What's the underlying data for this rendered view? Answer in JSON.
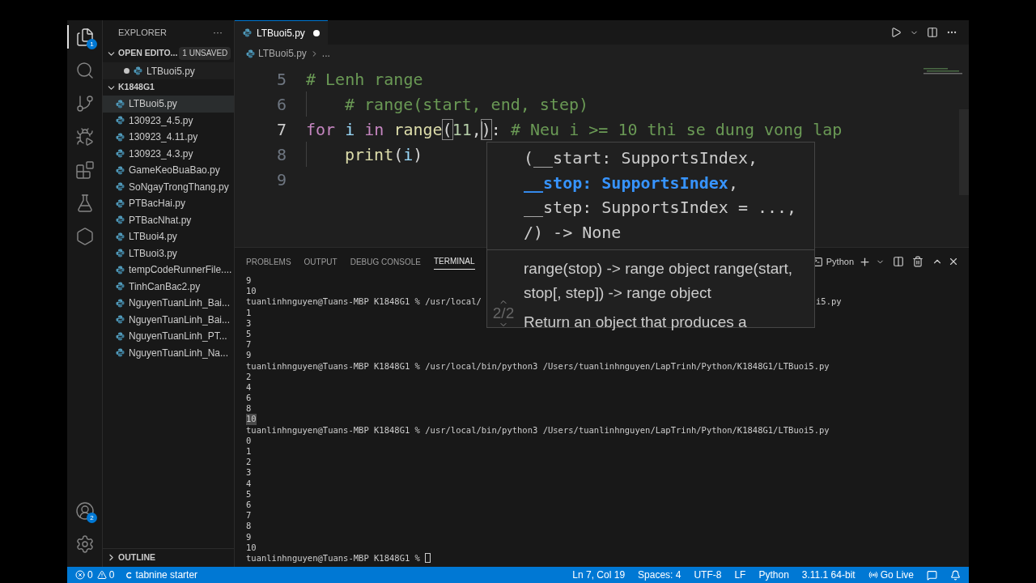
{
  "activity_bar": {
    "top": [
      {
        "kind": "files",
        "badge": "1",
        "selected": true
      },
      {
        "kind": "search",
        "selected": false
      },
      {
        "kind": "source-control",
        "selected": false
      },
      {
        "kind": "run-debug",
        "selected": false
      },
      {
        "kind": "extensions",
        "selected": false
      },
      {
        "kind": "testing",
        "selected": false
      },
      {
        "kind": "remote",
        "selected": false
      }
    ],
    "bottom": [
      {
        "kind": "account",
        "badge": "2"
      },
      {
        "kind": "settings"
      }
    ]
  },
  "sidebar": {
    "title": "EXPLORER",
    "more": "···",
    "open_editors": {
      "label": "OPEN EDITO...",
      "badge": "1 UNSAVED",
      "expanded": true,
      "items": [
        {
          "name": "LTBuoi5.py",
          "modified": true
        }
      ]
    },
    "folder": {
      "label": "K1848G1",
      "expanded": true,
      "files": [
        {
          "name": "LTBuoi5.py",
          "selected": true
        },
        {
          "name": "130923_4.5.py",
          "selected": false
        },
        {
          "name": "130923_4.11.py",
          "selected": false
        },
        {
          "name": "130923_4.3.py",
          "selected": false
        },
        {
          "name": "GameKeoBuaBao.py",
          "selected": false
        },
        {
          "name": "SoNgayTrongThang.py",
          "selected": false
        },
        {
          "name": "PTBacHai.py",
          "selected": false
        },
        {
          "name": "PTBacNhat.py",
          "selected": false
        },
        {
          "name": "LTBuoi4.py",
          "selected": false
        },
        {
          "name": "LTBuoi3.py",
          "selected": false
        },
        {
          "name": "tempCodeRunnerFile....",
          "selected": false
        },
        {
          "name": "TinhCanBac2.py",
          "selected": false
        },
        {
          "name": "NguyenTuanLinh_Bai...",
          "selected": false
        },
        {
          "name": "NguyenTuanLinh_Bai...",
          "selected": false
        },
        {
          "name": "NguyenTuanLinh_PT...",
          "selected": false
        },
        {
          "name": "NguyenTuanLinh_Na...",
          "selected": false
        }
      ]
    },
    "outline": {
      "label": "OUTLINE",
      "expanded": false
    }
  },
  "editor": {
    "tabs": [
      {
        "name": "LTBuoi5.py",
        "modified": true,
        "selected": true
      }
    ],
    "breadcrumbs": [
      "LTBuoi5.py",
      "..."
    ],
    "lines": [
      {
        "number": "5",
        "current": false,
        "tokens": [
          {
            "kind": "comment",
            "text": "# Lenh range"
          }
        ]
      },
      {
        "number": "6",
        "current": false,
        "indented": true,
        "tokens": [
          {
            "kind": "comment",
            "text": "# range(start, end, step)"
          }
        ]
      },
      {
        "number": "7",
        "current": true,
        "tokens": [
          {
            "kind": "keyword",
            "text": "for "
          },
          {
            "kind": "variable",
            "text": "i "
          },
          {
            "kind": "keyword",
            "text": "in "
          },
          {
            "kind": "function",
            "text": "range"
          },
          {
            "kind": "bracket",
            "text": "("
          },
          {
            "kind": "number",
            "text": "11"
          },
          {
            "kind": "plain",
            "text": ","
          },
          {
            "kind": "cursor"
          },
          {
            "kind": "bracket",
            "text": ")"
          },
          {
            "kind": "plain",
            "text": ":"
          },
          {
            "kind": "comment",
            "text": " # Neu i >= 10 thi se dung vong lap"
          }
        ]
      },
      {
        "number": "8",
        "current": false,
        "indented": true,
        "tokens": [
          {
            "kind": "function",
            "text": "print"
          },
          {
            "kind": "plain",
            "text": "("
          },
          {
            "kind": "variable",
            "text": "i"
          },
          {
            "kind": "plain",
            "text": ")"
          }
        ]
      },
      {
        "number": "9",
        "current": false
      }
    ],
    "signature_help": {
      "signature": [
        [
          {
            "text": "(__start: SupportsIndex,",
            "active": false
          }
        ],
        [
          {
            "text": "__stop: SupportsIndex",
            "active": true
          },
          {
            "text": ",",
            "active": false
          }
        ],
        [
          {
            "text": "__step: SupportsIndex = ...,",
            "active": false
          }
        ],
        [
          {
            "text": "/) -> None",
            "active": false
          }
        ]
      ],
      "docs": [
        "range(stop) -> range object range(start, stop[, step]) -> range object"
      ],
      "description": "Return an object that produces a",
      "counter": "2/2"
    }
  },
  "panel": {
    "tabs": [
      {
        "label": "PROBLEMS",
        "selected": false
      },
      {
        "label": "OUTPUT",
        "selected": false
      },
      {
        "label": "DEBUG CONSOLE",
        "selected": false
      },
      {
        "label": "TERMINAL",
        "selected": true
      }
    ],
    "shell": "Python",
    "terminal": [
      {
        "text": "9"
      },
      {
        "text": "10"
      },
      {
        "text": "tuanlinhnguyen@Tuans-MBP K1848G1 % /usr/local/",
        "tail": "i5.py"
      },
      {
        "text": "1"
      },
      {
        "text": "3"
      },
      {
        "text": "5"
      },
      {
        "text": "7"
      },
      {
        "text": "9"
      },
      {
        "text": "tuanlinhnguyen@Tuans-MBP K1848G1 % /usr/local/bin/python3 /Users/tuanlinhnguyen/LapTrinh/Python/K1848G1/LTBuoi5.py"
      },
      {
        "text": "2"
      },
      {
        "text": "4"
      },
      {
        "text": "6"
      },
      {
        "text": "8"
      },
      {
        "text": "10",
        "highlighted": true
      },
      {
        "text": "tuanlinhnguyen@Tuans-MBP K1848G1 % /usr/local/bin/python3 /Users/tuanlinhnguyen/LapTrinh/Python/K1848G1/LTBuoi5.py"
      },
      {
        "text": "0"
      },
      {
        "text": "1"
      },
      {
        "text": "2"
      },
      {
        "text": "3"
      },
      {
        "text": "4"
      },
      {
        "text": "5"
      },
      {
        "text": "6"
      },
      {
        "text": "7"
      },
      {
        "text": "8"
      },
      {
        "text": "9"
      },
      {
        "text": "10"
      },
      {
        "text": "tuanlinhnguyen@Tuans-MBP K1848G1 % ",
        "cursor": true
      }
    ]
  },
  "status_bar": {
    "errors": "0",
    "warnings": "0",
    "tabnine": "tabnine starter",
    "right": [
      {
        "kind": "text",
        "text": "Ln 7, Col 19"
      },
      {
        "kind": "text",
        "text": "Spaces: 4"
      },
      {
        "kind": "text",
        "text": "UTF-8"
      },
      {
        "kind": "text",
        "text": "LF"
      },
      {
        "kind": "text",
        "text": "Python"
      },
      {
        "kind": "text",
        "text": "3.11.1 64-bit"
      },
      {
        "kind": "golive",
        "text": "Go Live"
      },
      {
        "kind": "feedback"
      },
      {
        "kind": "bell"
      }
    ]
  }
}
